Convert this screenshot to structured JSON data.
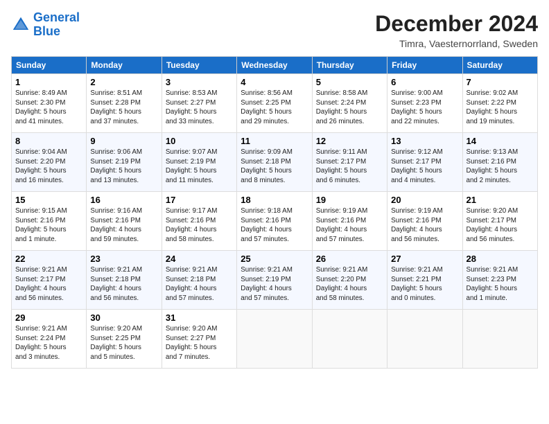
{
  "logo": {
    "line1": "General",
    "line2": "Blue"
  },
  "title": "December 2024",
  "location": "Timra, Vaesternorrland, Sweden",
  "days_of_week": [
    "Sunday",
    "Monday",
    "Tuesday",
    "Wednesday",
    "Thursday",
    "Friday",
    "Saturday"
  ],
  "weeks": [
    [
      {
        "day": "1",
        "info": "Sunrise: 8:49 AM\nSunset: 2:30 PM\nDaylight: 5 hours\nand 41 minutes."
      },
      {
        "day": "2",
        "info": "Sunrise: 8:51 AM\nSunset: 2:28 PM\nDaylight: 5 hours\nand 37 minutes."
      },
      {
        "day": "3",
        "info": "Sunrise: 8:53 AM\nSunset: 2:27 PM\nDaylight: 5 hours\nand 33 minutes."
      },
      {
        "day": "4",
        "info": "Sunrise: 8:56 AM\nSunset: 2:25 PM\nDaylight: 5 hours\nand 29 minutes."
      },
      {
        "day": "5",
        "info": "Sunrise: 8:58 AM\nSunset: 2:24 PM\nDaylight: 5 hours\nand 26 minutes."
      },
      {
        "day": "6",
        "info": "Sunrise: 9:00 AM\nSunset: 2:23 PM\nDaylight: 5 hours\nand 22 minutes."
      },
      {
        "day": "7",
        "info": "Sunrise: 9:02 AM\nSunset: 2:22 PM\nDaylight: 5 hours\nand 19 minutes."
      }
    ],
    [
      {
        "day": "8",
        "info": "Sunrise: 9:04 AM\nSunset: 2:20 PM\nDaylight: 5 hours\nand 16 minutes."
      },
      {
        "day": "9",
        "info": "Sunrise: 9:06 AM\nSunset: 2:19 PM\nDaylight: 5 hours\nand 13 minutes."
      },
      {
        "day": "10",
        "info": "Sunrise: 9:07 AM\nSunset: 2:19 PM\nDaylight: 5 hours\nand 11 minutes."
      },
      {
        "day": "11",
        "info": "Sunrise: 9:09 AM\nSunset: 2:18 PM\nDaylight: 5 hours\nand 8 minutes."
      },
      {
        "day": "12",
        "info": "Sunrise: 9:11 AM\nSunset: 2:17 PM\nDaylight: 5 hours\nand 6 minutes."
      },
      {
        "day": "13",
        "info": "Sunrise: 9:12 AM\nSunset: 2:17 PM\nDaylight: 5 hours\nand 4 minutes."
      },
      {
        "day": "14",
        "info": "Sunrise: 9:13 AM\nSunset: 2:16 PM\nDaylight: 5 hours\nand 2 minutes."
      }
    ],
    [
      {
        "day": "15",
        "info": "Sunrise: 9:15 AM\nSunset: 2:16 PM\nDaylight: 5 hours\nand 1 minute."
      },
      {
        "day": "16",
        "info": "Sunrise: 9:16 AM\nSunset: 2:16 PM\nDaylight: 4 hours\nand 59 minutes."
      },
      {
        "day": "17",
        "info": "Sunrise: 9:17 AM\nSunset: 2:16 PM\nDaylight: 4 hours\nand 58 minutes."
      },
      {
        "day": "18",
        "info": "Sunrise: 9:18 AM\nSunset: 2:16 PM\nDaylight: 4 hours\nand 57 minutes."
      },
      {
        "day": "19",
        "info": "Sunrise: 9:19 AM\nSunset: 2:16 PM\nDaylight: 4 hours\nand 57 minutes."
      },
      {
        "day": "20",
        "info": "Sunrise: 9:19 AM\nSunset: 2:16 PM\nDaylight: 4 hours\nand 56 minutes."
      },
      {
        "day": "21",
        "info": "Sunrise: 9:20 AM\nSunset: 2:17 PM\nDaylight: 4 hours\nand 56 minutes."
      }
    ],
    [
      {
        "day": "22",
        "info": "Sunrise: 9:21 AM\nSunset: 2:17 PM\nDaylight: 4 hours\nand 56 minutes."
      },
      {
        "day": "23",
        "info": "Sunrise: 9:21 AM\nSunset: 2:18 PM\nDaylight: 4 hours\nand 56 minutes."
      },
      {
        "day": "24",
        "info": "Sunrise: 9:21 AM\nSunset: 2:18 PM\nDaylight: 4 hours\nand 57 minutes."
      },
      {
        "day": "25",
        "info": "Sunrise: 9:21 AM\nSunset: 2:19 PM\nDaylight: 4 hours\nand 57 minutes."
      },
      {
        "day": "26",
        "info": "Sunrise: 9:21 AM\nSunset: 2:20 PM\nDaylight: 4 hours\nand 58 minutes."
      },
      {
        "day": "27",
        "info": "Sunrise: 9:21 AM\nSunset: 2:21 PM\nDaylight: 5 hours\nand 0 minutes."
      },
      {
        "day": "28",
        "info": "Sunrise: 9:21 AM\nSunset: 2:23 PM\nDaylight: 5 hours\nand 1 minute."
      }
    ],
    [
      {
        "day": "29",
        "info": "Sunrise: 9:21 AM\nSunset: 2:24 PM\nDaylight: 5 hours\nand 3 minutes."
      },
      {
        "day": "30",
        "info": "Sunrise: 9:20 AM\nSunset: 2:25 PM\nDaylight: 5 hours\nand 5 minutes."
      },
      {
        "day": "31",
        "info": "Sunrise: 9:20 AM\nSunset: 2:27 PM\nDaylight: 5 hours\nand 7 minutes."
      },
      {
        "day": "",
        "info": ""
      },
      {
        "day": "",
        "info": ""
      },
      {
        "day": "",
        "info": ""
      },
      {
        "day": "",
        "info": ""
      }
    ]
  ]
}
